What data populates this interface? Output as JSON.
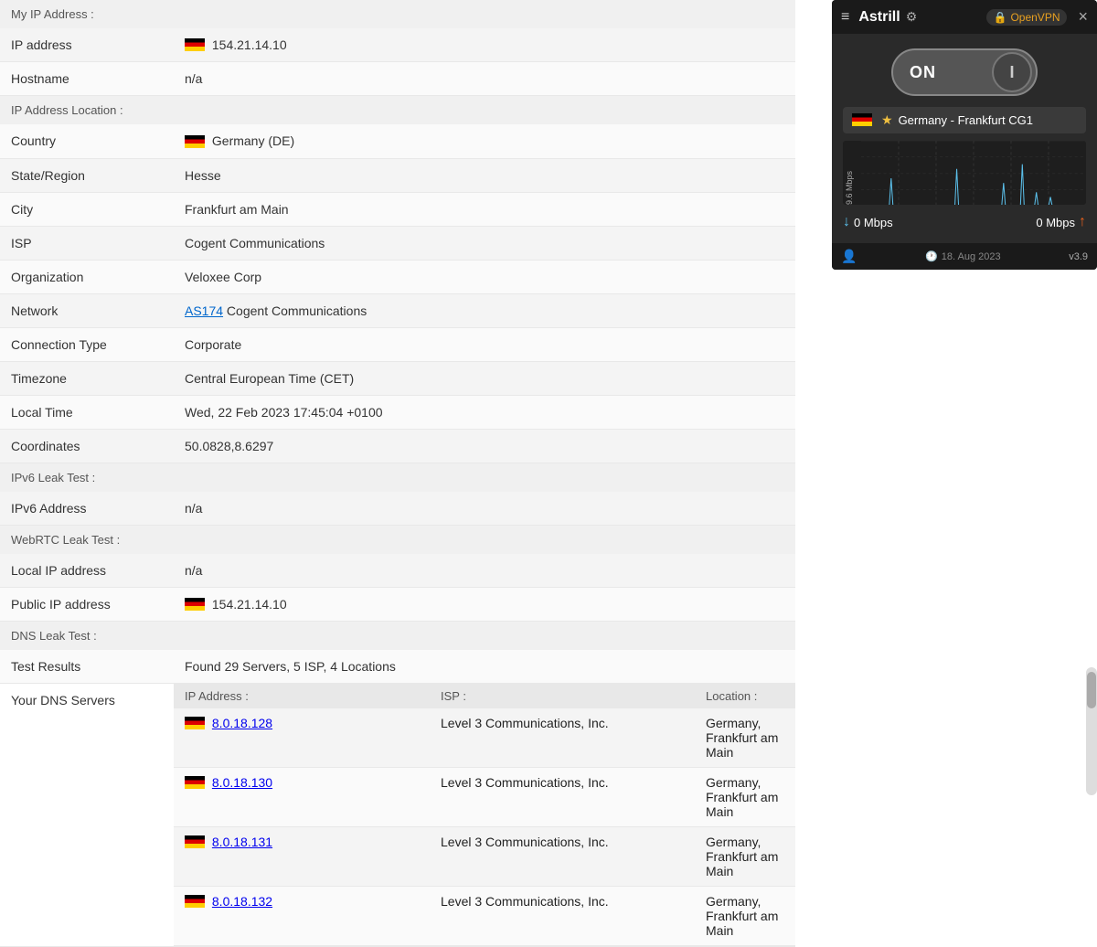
{
  "page": {
    "title": "My IP Address :",
    "sections": {
      "my_ip": {
        "label": "My IP Address :",
        "rows": [
          {
            "label": "IP address",
            "value": "154.21.14.10",
            "flag": true
          },
          {
            "label": "Hostname",
            "value": "n/a",
            "flag": false
          }
        ]
      },
      "ip_location": {
        "label": "IP Address Location :",
        "rows": [
          {
            "label": "Country",
            "value": "Germany (DE)",
            "flag": true
          },
          {
            "label": "State/Region",
            "value": "Hesse",
            "flag": false
          },
          {
            "label": "City",
            "value": "Frankfurt am Main",
            "flag": false
          },
          {
            "label": "ISP",
            "value": "Cogent Communications",
            "flag": false
          },
          {
            "label": "Organization",
            "value": "Veloxee Corp",
            "flag": false
          },
          {
            "label": "Network",
            "value": "AS174 Cogent Communications",
            "flag": false,
            "link": "AS174"
          },
          {
            "label": "Connection Type",
            "value": "Corporate",
            "flag": false
          },
          {
            "label": "Timezone",
            "value": "Central European Time (CET)",
            "flag": false
          },
          {
            "label": "Local Time",
            "value": "Wed, 22 Feb 2023 17:45:04 +0100",
            "flag": false
          },
          {
            "label": "Coordinates",
            "value": "50.0828,8.6297",
            "flag": false
          }
        ]
      },
      "ipv6": {
        "label": "IPv6 Leak Test :",
        "rows": [
          {
            "label": "IPv6 Address",
            "value": "n/a",
            "flag": false
          }
        ]
      },
      "webrtc": {
        "label": "WebRTC Leak Test :",
        "rows": [
          {
            "label": "Local IP address",
            "value": "n/a",
            "flag": false
          },
          {
            "label": "Public IP address",
            "value": "154.21.14.10",
            "flag": true
          }
        ]
      },
      "dns": {
        "label": "DNS Leak Test :",
        "test_results_label": "Test Results",
        "test_results_value": "Found 29 Servers, 5 ISP, 4 Locations",
        "your_dns_label": "Your DNS Servers",
        "table_headers": {
          "ip": "IP Address :",
          "isp": "ISP :",
          "location": "Location :"
        },
        "dns_rows": [
          {
            "ip": "8.0.18.128",
            "isp": "Level 3 Communications, Inc.",
            "location": "Germany, Frankfurt am Main",
            "flag": true
          },
          {
            "ip": "8.0.18.130",
            "isp": "Level 3 Communications, Inc.",
            "location": "Germany, Frankfurt am Main",
            "flag": true
          },
          {
            "ip": "8.0.18.131",
            "isp": "Level 3 Communications, Inc.",
            "location": "Germany, Frankfurt am Main",
            "flag": true
          },
          {
            "ip": "8.0.18.132",
            "isp": "Level 3 Communications, Inc.",
            "location": "Germany, Frankfurt am Main",
            "flag": true
          }
        ]
      }
    }
  },
  "astrill": {
    "title": "Astrill",
    "protocol": "OpenVPN",
    "toggle_state": "ON",
    "toggle_icon": "I",
    "server": "Germany - Frankfurt CG1",
    "speed_label_mbps": "9.6 Mbps",
    "download_speed": "0 Mbps",
    "upload_speed": "0 Mbps",
    "date": "18. Aug 2023",
    "version": "v3.9",
    "close_label": "×",
    "menu_label": "≡"
  }
}
